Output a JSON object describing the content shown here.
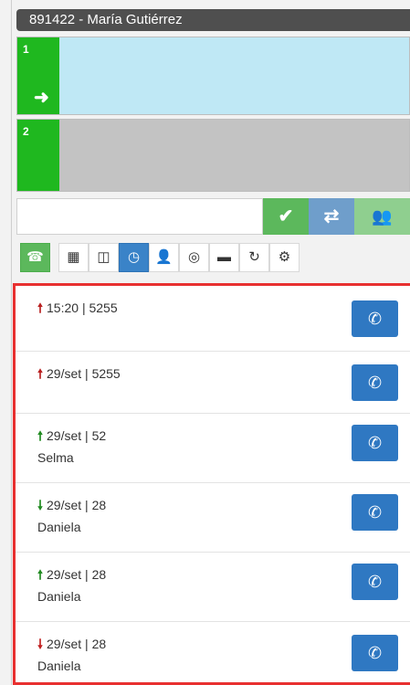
{
  "header": {
    "title": "891422 - María Gutiérrez"
  },
  "lines": [
    {
      "number": "1",
      "status_icon": "arrow-right-icon",
      "color": "#bfe8f5"
    },
    {
      "number": "2",
      "color": "#c3c3c3"
    }
  ],
  "dialer": {
    "input_value": "",
    "input_placeholder": "",
    "buttons": [
      {
        "icon": "checkmark-icon",
        "glyph": "✔"
      },
      {
        "icon": "transfer-icon",
        "glyph": "⇄"
      },
      {
        "icon": "conference-icon",
        "glyph": "👥"
      }
    ]
  },
  "toolbar": {
    "active_tab": "history",
    "tabs": [
      {
        "icon": "phone-icon",
        "glyph": "☎"
      },
      {
        "icon": "dialpad-icon",
        "glyph": "▦"
      },
      {
        "icon": "table-icon",
        "glyph": "◫"
      },
      {
        "icon": "clock-icon",
        "glyph": "◷"
      },
      {
        "icon": "user-icon",
        "glyph": "👤"
      },
      {
        "icon": "globe-icon",
        "glyph": "◎"
      },
      {
        "icon": "chat-icon",
        "glyph": "▬"
      },
      {
        "icon": "refresh-icon",
        "glyph": "↻"
      },
      {
        "icon": "gear-icon",
        "glyph": "⚙"
      }
    ]
  },
  "history": [
    {
      "direction": "up",
      "color": "#b81f1f",
      "arrow": "🠕",
      "text": "15:20 | 5255",
      "name": ""
    },
    {
      "direction": "up",
      "color": "#b81f1f",
      "arrow": "🠕",
      "text": "29/set | 5255",
      "name": ""
    },
    {
      "direction": "up",
      "color": "#208a20",
      "arrow": "🠕",
      "text": "29/set | 52",
      "name": "Selma"
    },
    {
      "direction": "down",
      "color": "#208a20",
      "arrow": "🠗",
      "text": "29/set | 28",
      "name": "Daniela"
    },
    {
      "direction": "up",
      "color": "#208a20",
      "arrow": "🠕",
      "text": "29/set | 28",
      "name": "Daniela"
    },
    {
      "direction": "down",
      "color": "#c02020",
      "arrow": "🠗",
      "text": "29/set | 28",
      "name": "Daniela"
    }
  ],
  "colors": {
    "accent_green": "#1fb81f",
    "accent_blue": "#2f78c2",
    "highlight_border": "#e83030"
  }
}
